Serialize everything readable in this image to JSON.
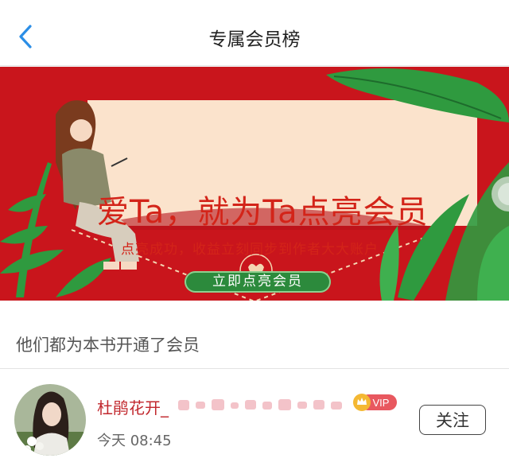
{
  "header": {
    "title": "专属会员榜",
    "back_icon": "chevron-left-icon"
  },
  "banner": {
    "title": "爱Ta，就为Ta点亮会员",
    "subtitle": "点亮成功，收益立刻同步到作者大大账户",
    "button_label": "立即点亮会员",
    "colors": {
      "background": "#c9151c",
      "card": "#fbe3cc",
      "button": "#2c8a3c"
    }
  },
  "section": {
    "label": "他们都为本书开通了会员"
  },
  "members": [
    {
      "name": "杜鹃花开_",
      "badge": "VIP",
      "time": "今天 08:45",
      "follow_label": "关注"
    }
  ]
}
